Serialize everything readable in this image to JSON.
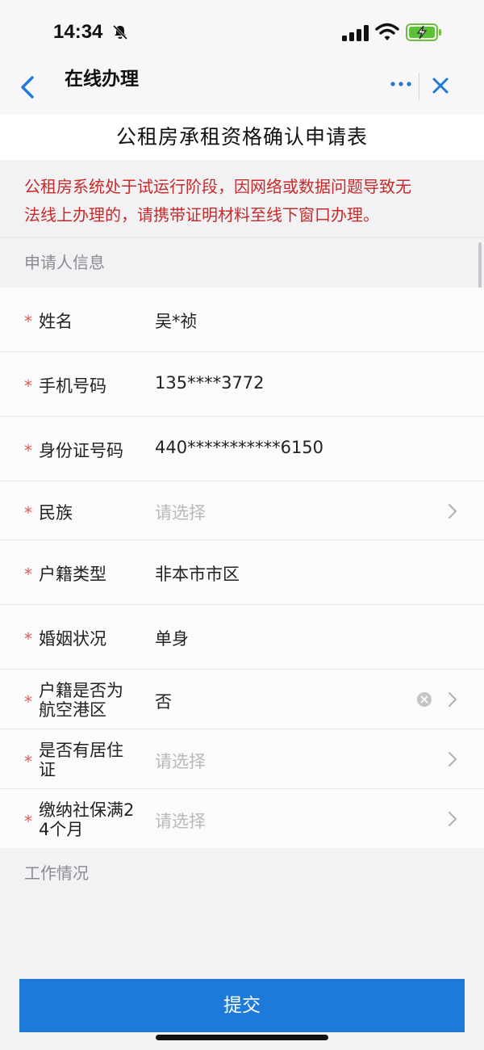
{
  "status_bar": {
    "time": "14:34"
  },
  "nav": {
    "title": "在线办理"
  },
  "form": {
    "title": "公租房承租资格确认申请表",
    "notice_line1": "公租房系统处于试运行阶段，因网络或数据问题导致无",
    "notice_line2": "法线上办理的，请携带证明材料至线下窗口办理。",
    "section_applicant": "申请人信息",
    "section_work": "工作情况",
    "fields": [
      {
        "label": "姓名",
        "value": "吴*祯"
      },
      {
        "label": "手机号码",
        "value": "135****3772"
      },
      {
        "label": "身份证号码",
        "value": "440***********6150"
      },
      {
        "label": "民族",
        "value": "请选择"
      },
      {
        "label": "户籍类型",
        "value": "非本市市区"
      },
      {
        "label": "婚姻状况",
        "value": "单身"
      },
      {
        "label_line1": "户籍是否为",
        "label_line2": "航空港区",
        "value": "否"
      },
      {
        "label_line1": "是否有居住",
        "label_line2": "证",
        "value": "请选择"
      },
      {
        "label_line1": "缴纳社保满2",
        "label_line2": "4个月",
        "value": "请选择"
      }
    ],
    "required_mark": "*",
    "submit_label": "提交"
  },
  "colors": {
    "accent": "#1e7ad8",
    "notice_red": "#c62a2a",
    "required_red": "#e35a5a",
    "placeholder_gray": "#b8b8bd"
  }
}
